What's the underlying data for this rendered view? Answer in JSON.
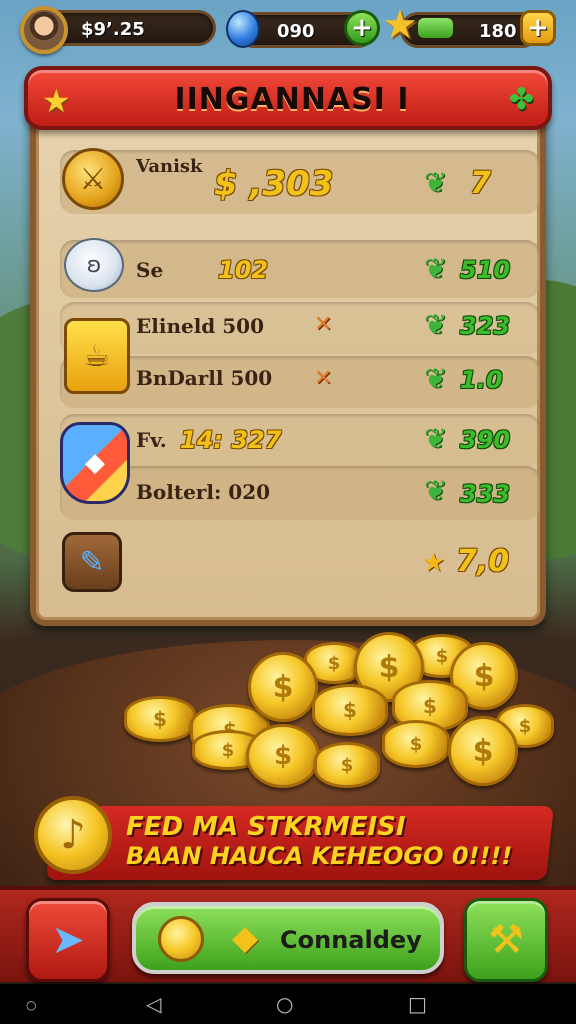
{
  "topbar": {
    "coins_text": "$9’.25",
    "gems_text": "090",
    "stars_text": "180",
    "plus_label": "+",
    "energy_fill": 0.35
  },
  "panel": {
    "title": "IINGANNASI I",
    "rows": [
      {
        "label": "Vanisk",
        "value": "$ ,303",
        "reward": "7"
      },
      {
        "label": "Se",
        "value": "102",
        "reward": "510"
      },
      {
        "label": "Elineld 500",
        "value": "",
        "reward": "323"
      },
      {
        "label": "BnDarll 500",
        "value": "",
        "reward": "1.0"
      },
      {
        "label": "Fv.",
        "value": "14: 327",
        "reward": "390"
      },
      {
        "label": "Bolterl: 020",
        "value": "",
        "reward": "333"
      }
    ],
    "total_value": "7,0"
  },
  "promo": {
    "line1": "FED MA STKRMEISI",
    "line2": "BAAN HAUCA KEHEOGO 0!!!!"
  },
  "bottombar": {
    "main_label": "Connaldey"
  },
  "colors": {
    "accent_red": "#c11d16",
    "accent_green": "#3ea21c",
    "gold": "#f6c829"
  }
}
